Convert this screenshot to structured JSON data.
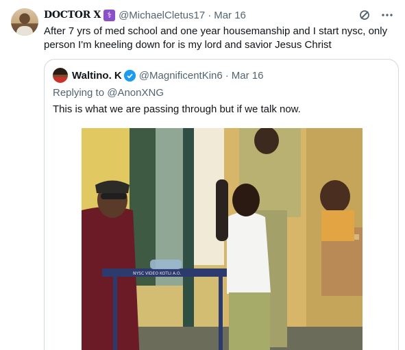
{
  "tweet": {
    "display_name": "DOCTOR X",
    "affiliate_badge": "⚕",
    "handle": "@MichaelCletus17",
    "separator": "·",
    "time": "Mar 16",
    "text": "After 7 yrs of med school and one year housemanship and I start nysc, only person I'm kneeling down for is my lord and savior Jesus Christ",
    "icons": {
      "grok": "grok-icon",
      "more": "more-icon"
    }
  },
  "quote": {
    "display_name": "Waltino. K",
    "verified_icon": "verified-icon",
    "handle": "@MagnificentKin6",
    "separator": "·",
    "time": "Mar 16",
    "replying_prefix": "Replying to ",
    "replying_to": "@AnonXNG",
    "text": "This is what we are passing through but if we talk now.",
    "media_table_label": "NYSC VIDEO KOTLI A.O."
  },
  "colors": {
    "text_primary": "#0f1419",
    "text_secondary": "#536471",
    "verified_blue": "#1d9bf0",
    "border": "#cfd9de",
    "affiliate_purple": "#8b4fc9"
  }
}
